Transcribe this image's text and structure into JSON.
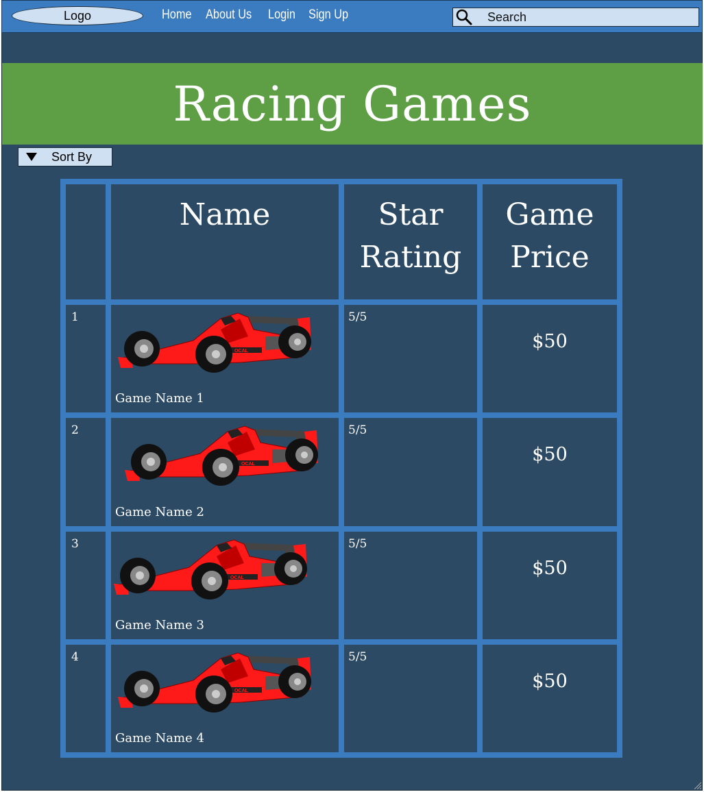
{
  "nav": {
    "logo": "Logo",
    "links": [
      "Home",
      "About Us",
      "Login",
      "Sign Up"
    ],
    "search_placeholder": "Search",
    "search_icon": "search-icon"
  },
  "banner": {
    "title": "Racing Games"
  },
  "sort": {
    "label": "Sort By",
    "icon": "triangle-down-icon"
  },
  "table": {
    "headers": [
      "",
      "Name",
      "Star Rating",
      "Game Price"
    ],
    "rows": [
      {
        "index": "1",
        "name": "Game Name 1",
        "rating": "5/5",
        "price": "$50"
      },
      {
        "index": "2",
        "name": "Game Name 2",
        "rating": "5/5",
        "price": "$50"
      },
      {
        "index": "3",
        "name": "Game Name 3",
        "rating": "5/5",
        "price": "$50"
      },
      {
        "index": "4",
        "name": "Game Name 4",
        "rating": "5/5",
        "price": "$50"
      }
    ]
  },
  "colors": {
    "background": "#2c4a64",
    "navbar": "#3b7bbf",
    "banner": "#5e9e45",
    "input": "#cfe0f3",
    "car": "#ff1a1a"
  }
}
